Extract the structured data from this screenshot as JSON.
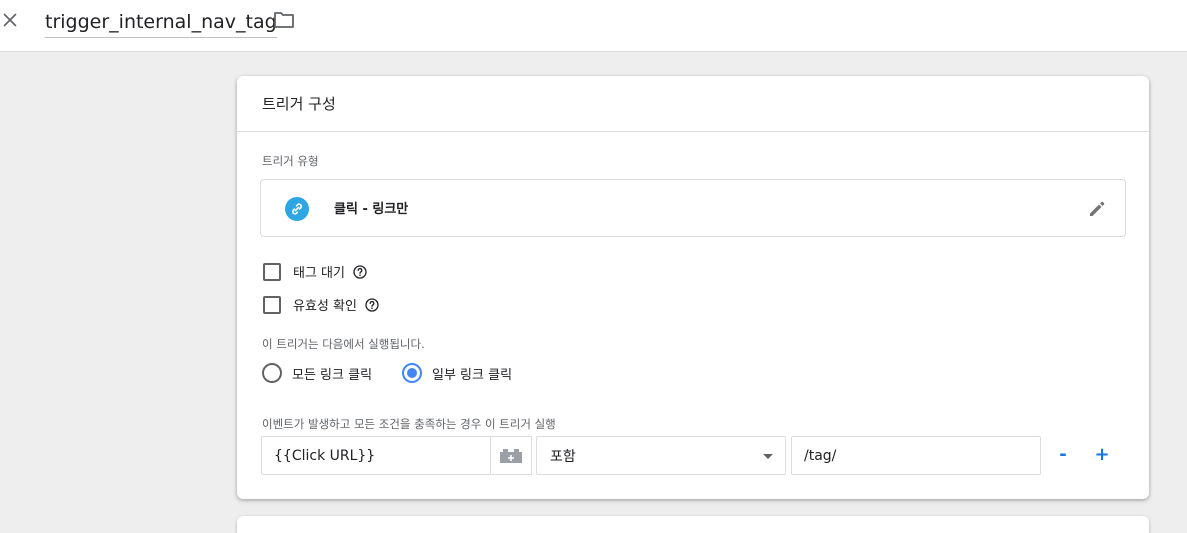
{
  "header": {
    "title": "trigger_internal_nav_tag",
    "close_icon": "close-icon",
    "folder_icon": "folder-icon"
  },
  "trigger_config": {
    "title": "트리거 구성",
    "type_section_label": "트리거 유형",
    "trigger_type": {
      "name": "클릭 - 링크만",
      "icon": "link-icon",
      "icon_color": "#2ea6e3"
    },
    "checkboxes": [
      {
        "label": "태그 대기",
        "checked": false
      },
      {
        "label": "유효성 확인",
        "checked": false
      }
    ],
    "fire_on_label": "이 트리거는 다음에서 실행됩니다.",
    "fire_on_options": [
      {
        "label": "모든 링크 클릭",
        "selected": false
      },
      {
        "label": "일부 링크 클릭",
        "selected": true
      }
    ],
    "condition_label": "이벤트가 발생하고 모든 조건을 충족하는 경우 이 트리거 실행",
    "condition": {
      "variable": "{{Click URL}}",
      "operator": "포함",
      "value": "/tag/",
      "remove_label": "-",
      "add_label": "+"
    },
    "accent_color": "#4285f4",
    "action_color": "#1a73e8"
  }
}
